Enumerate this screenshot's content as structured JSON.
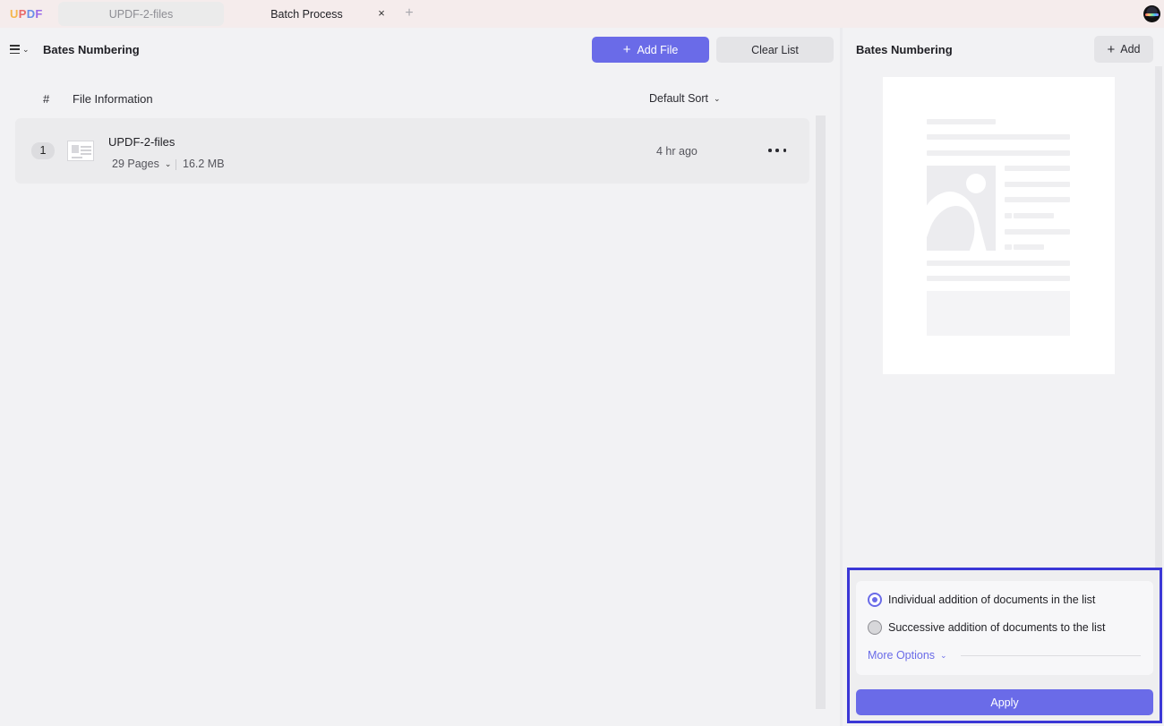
{
  "app": {
    "logo_letters": [
      {
        "char": "U",
        "color": "#f5b64b"
      },
      {
        "char": "P",
        "color": "#e86a6a"
      },
      {
        "char": "D",
        "color": "#6a8fe8"
      },
      {
        "char": "F",
        "color": "#9b6ae8"
      }
    ]
  },
  "tabs": [
    {
      "label": "UPDF-2-files",
      "active": false
    },
    {
      "label": "Batch Process",
      "active": true,
      "close_icon": "×"
    }
  ],
  "new_tab_icon": "+",
  "left_panel": {
    "title": "Bates Numbering",
    "add_file_label": "Add File",
    "clear_list_label": "Clear List",
    "columns": {
      "index": "#",
      "info": "File Information"
    },
    "sort_label": "Default Sort",
    "files": [
      {
        "index": "1",
        "name": "UPDF-2-files",
        "pages": "29 Pages",
        "size": "16.2 MB",
        "time": "4 hr ago"
      }
    ]
  },
  "right_panel": {
    "title": "Bates Numbering",
    "add_label": "Add",
    "options": {
      "option_1": "Individual addition of documents in the list",
      "option_2": "Successive addition of documents to the list",
      "selected": "option_1",
      "more_options_label": "More Options"
    },
    "apply_label": "Apply"
  },
  "colors": {
    "accent": "#6a6be8",
    "highlight_frame": "#3b37d6"
  },
  "icons": {
    "chevron": "⌄",
    "plus": "+"
  }
}
